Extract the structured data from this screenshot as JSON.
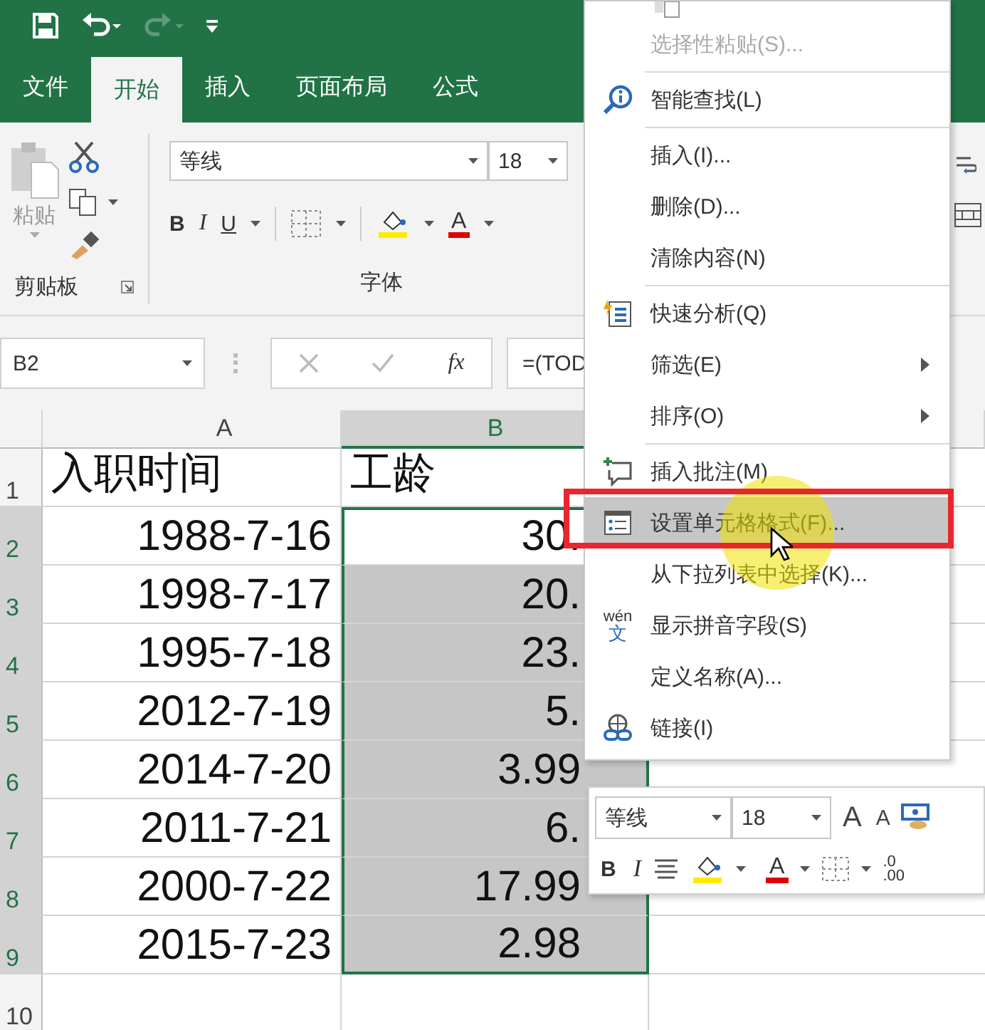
{
  "tabs": [
    {
      "label": "文件",
      "selected": false
    },
    {
      "label": "开始",
      "selected": true
    },
    {
      "label": "插入",
      "selected": false
    },
    {
      "label": "页面布局",
      "selected": false
    },
    {
      "label": "公式",
      "selected": false
    }
  ],
  "ribbon": {
    "paste_label": "粘贴",
    "clipboard_label": "剪贴板",
    "font_name": "等线",
    "font_size": "18",
    "bold": "B",
    "italic": "I",
    "underline": "U",
    "font_color": "A",
    "font_label": "字体"
  },
  "formula_bar": {
    "name_box": "B2",
    "function_label": "fx",
    "formula": "=(TOD"
  },
  "sheet": {
    "columns": [
      {
        "label": "A",
        "selected": false
      },
      {
        "label": "B",
        "selected": true
      }
    ],
    "rows": [
      {
        "header": "1",
        "selected": false,
        "cells": [
          {
            "kind": "text",
            "text": "入职时间",
            "selected": false,
            "active": false
          },
          {
            "kind": "text",
            "text": "工龄",
            "selected": false,
            "active": false
          }
        ]
      },
      {
        "header": "2",
        "selected": true,
        "cells": [
          {
            "kind": "number",
            "text": "1988-7-16",
            "selected": false,
            "active": false
          },
          {
            "kind": "number",
            "text": "30.",
            "selected": true,
            "active": true
          }
        ]
      },
      {
        "header": "3",
        "selected": true,
        "cells": [
          {
            "kind": "number",
            "text": "1998-7-17",
            "selected": false,
            "active": false
          },
          {
            "kind": "number",
            "text": "20.",
            "selected": true,
            "active": false
          }
        ]
      },
      {
        "header": "4",
        "selected": true,
        "cells": [
          {
            "kind": "number",
            "text": "1995-7-18",
            "selected": false,
            "active": false
          },
          {
            "kind": "number",
            "text": "23.",
            "selected": true,
            "active": false
          }
        ]
      },
      {
        "header": "5",
        "selected": true,
        "cells": [
          {
            "kind": "number",
            "text": "2012-7-19",
            "selected": false,
            "active": false
          },
          {
            "kind": "number",
            "text": "5.",
            "selected": true,
            "active": false
          }
        ]
      },
      {
        "header": "6",
        "selected": true,
        "cells": [
          {
            "kind": "number",
            "text": "2014-7-20",
            "selected": false,
            "active": false
          },
          {
            "kind": "number",
            "text": "3.99",
            "selected": true,
            "active": false
          }
        ]
      },
      {
        "header": "7",
        "selected": true,
        "cells": [
          {
            "kind": "number",
            "text": "2011-7-21",
            "selected": false,
            "active": false
          },
          {
            "kind": "number",
            "text": "6.",
            "selected": true,
            "active": false
          }
        ]
      },
      {
        "header": "8",
        "selected": true,
        "cells": [
          {
            "kind": "number",
            "text": "2000-7-22",
            "selected": false,
            "active": false
          },
          {
            "kind": "number",
            "text": "17.99",
            "selected": true,
            "active": false
          }
        ]
      },
      {
        "header": "9",
        "selected": true,
        "cells": [
          {
            "kind": "number",
            "text": "2015-7-23",
            "selected": false,
            "active": false
          },
          {
            "kind": "number",
            "text": "2.98",
            "selected": true,
            "active": false
          }
        ]
      },
      {
        "header": "10",
        "selected": false,
        "cells": []
      }
    ]
  },
  "context_menu": {
    "items": [
      {
        "kind": "plain",
        "label": "选择性粘贴(S)...",
        "disabled": true,
        "highlighted": false,
        "submenu": false
      },
      {
        "kind": "separator"
      },
      {
        "kind": "lookup",
        "label": "智能查找(L)",
        "disabled": false,
        "highlighted": false,
        "submenu": false
      },
      {
        "kind": "separator"
      },
      {
        "kind": "plain",
        "label": "插入(I)...",
        "disabled": false,
        "highlighted": false,
        "submenu": false
      },
      {
        "kind": "plain",
        "label": "删除(D)...",
        "disabled": false,
        "highlighted": false,
        "submenu": false
      },
      {
        "kind": "plain",
        "label": "清除内容(N)",
        "disabled": false,
        "highlighted": false,
        "submenu": false
      },
      {
        "kind": "separator"
      },
      {
        "kind": "analysis",
        "label": "快速分析(Q)",
        "disabled": false,
        "highlighted": false,
        "submenu": false
      },
      {
        "kind": "plain",
        "label": "筛选(E)",
        "disabled": false,
        "highlighted": false,
        "submenu": true
      },
      {
        "kind": "plain",
        "label": "排序(O)",
        "disabled": false,
        "highlighted": false,
        "submenu": true
      },
      {
        "kind": "separator"
      },
      {
        "kind": "comment",
        "label": "插入批注(M)",
        "disabled": false,
        "highlighted": false,
        "submenu": false
      },
      {
        "kind": "format",
        "label": "设置单元格格式(F)...",
        "disabled": false,
        "highlighted": true,
        "submenu": false
      },
      {
        "kind": "plain",
        "label": "从下拉列表中选择(K)...",
        "disabled": false,
        "highlighted": false,
        "submenu": false
      },
      {
        "kind": "phonetic",
        "label": "显示拼音字段(S)",
        "icon_top": "wén",
        "icon_bottom": "文",
        "disabled": false,
        "highlighted": false,
        "submenu": false
      },
      {
        "kind": "plain",
        "label": "定义名称(A)...",
        "disabled": false,
        "highlighted": false,
        "submenu": false
      },
      {
        "kind": "link",
        "label": "链接(I)",
        "disabled": false,
        "highlighted": false,
        "submenu": false
      }
    ]
  },
  "mini_toolbar": {
    "font_name": "等线",
    "font_size": "18",
    "grow_font": "A",
    "shrink_font": "A",
    "bold": "B",
    "italic": "I",
    "font_color": "A",
    "decimal_top": ".0",
    "decimal_bottom": ".00"
  }
}
